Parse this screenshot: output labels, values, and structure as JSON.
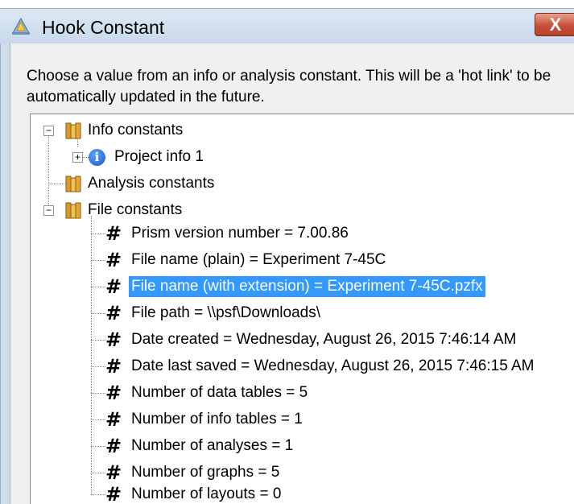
{
  "window": {
    "title": "Hook Constant",
    "close_label": "X"
  },
  "description": "Choose a value from an info or analysis constant. This will be a 'hot link' to be automatically updated in the future.",
  "tree": {
    "info_constants": {
      "label": "Info constants",
      "expander": "−",
      "children": [
        {
          "label": "Project info 1",
          "expander": "+"
        }
      ]
    },
    "analysis_constants": {
      "label": "Analysis constants"
    },
    "file_constants": {
      "label": "File constants",
      "expander": "−",
      "children": [
        {
          "label": "Prism version number = 7.00.86"
        },
        {
          "label": "File name (plain) = Experiment 7-45C"
        },
        {
          "label": "File name (with extension) = Experiment 7-45C.pzfx",
          "selected": true
        },
        {
          "label": "File path = \\\\psf\\Downloads\\"
        },
        {
          "label": "Date created = Wednesday, August 26, 2015 7:46:14 AM"
        },
        {
          "label": "Date last saved = Wednesday, August 26, 2015 7:46:15 AM"
        },
        {
          "label": "Number of data tables = 5"
        },
        {
          "label": "Number of info tables = 1"
        },
        {
          "label": "Number of analyses = 1"
        },
        {
          "label": "Number of graphs = 5"
        },
        {
          "label": "Number of layouts = 0"
        }
      ]
    }
  },
  "colors": {
    "selection": "#3399ff",
    "close_button": "#c7503a",
    "title_bar": "#cfdcea"
  }
}
